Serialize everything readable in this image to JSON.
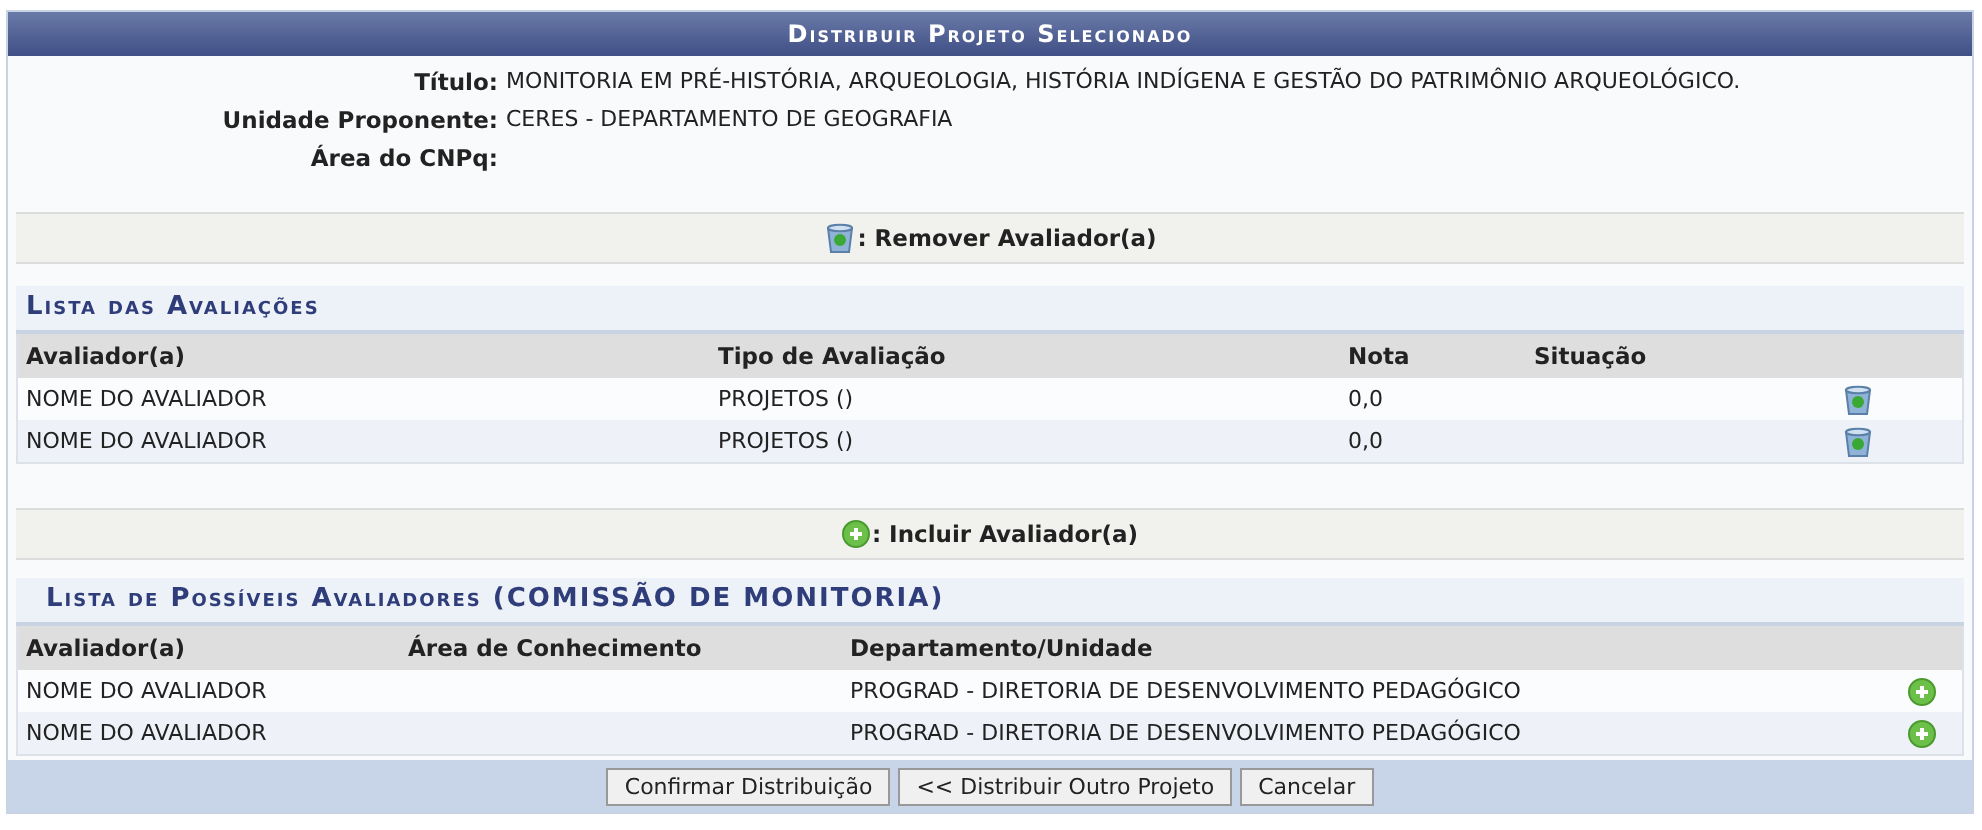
{
  "title": "Distribuir Projeto Selecionado",
  "details": [
    {
      "label": "Título:",
      "value": "MONITORIA EM PRÉ-HISTÓRIA, ARQUEOLOGIA, HISTÓRIA INDÍGENA E GESTÃO DO PATRIMÔNIO ARQUEOLÓGICO."
    },
    {
      "label": "Unidade Proponente:",
      "value": "CERES - DEPARTAMENTO DE GEOGRAFIA"
    },
    {
      "label": "Área do CNPq:"
    }
  ],
  "evaluations": {
    "legend": ": Remover Avaliador(a)",
    "heading": "Lista das Avaliações",
    "columns": [
      "Avaliador(a)",
      "Tipo de Avaliação",
      "Nota",
      "Situação"
    ],
    "rows": [
      {
        "cells": [
          "NOME DO AVALIADOR",
          "PROJETOS ()",
          "0,0"
        ]
      },
      {
        "cells": [
          "NOME DO AVALIADOR",
          "PROJETOS ()",
          "0,0"
        ]
      }
    ]
  },
  "candidates": {
    "legend": ": Incluir Avaliador(a)",
    "heading": "Lista de Possíveis Avaliadores (COMISSÃO DE MONITORIA)",
    "columns": [
      "Avaliador(a)",
      "Área de Conhecimento",
      "Departamento/Unidade"
    ],
    "rows": [
      {
        "cells": [
          "NOME DO AVALIADOR",
          "",
          "PROGRAD - DIRETORIA DE DESENVOLVIMENTO PEDAGÓGICO"
        ]
      },
      {
        "cells": [
          "NOME DO AVALIADOR",
          "",
          "PROGRAD - DIRETORIA DE DESENVOLVIMENTO PEDAGÓGICO"
        ]
      }
    ]
  },
  "buttons": [
    "Confirmar Distribuição",
    "<< Distribuir Outro Projeto",
    "Cancelar"
  ]
}
